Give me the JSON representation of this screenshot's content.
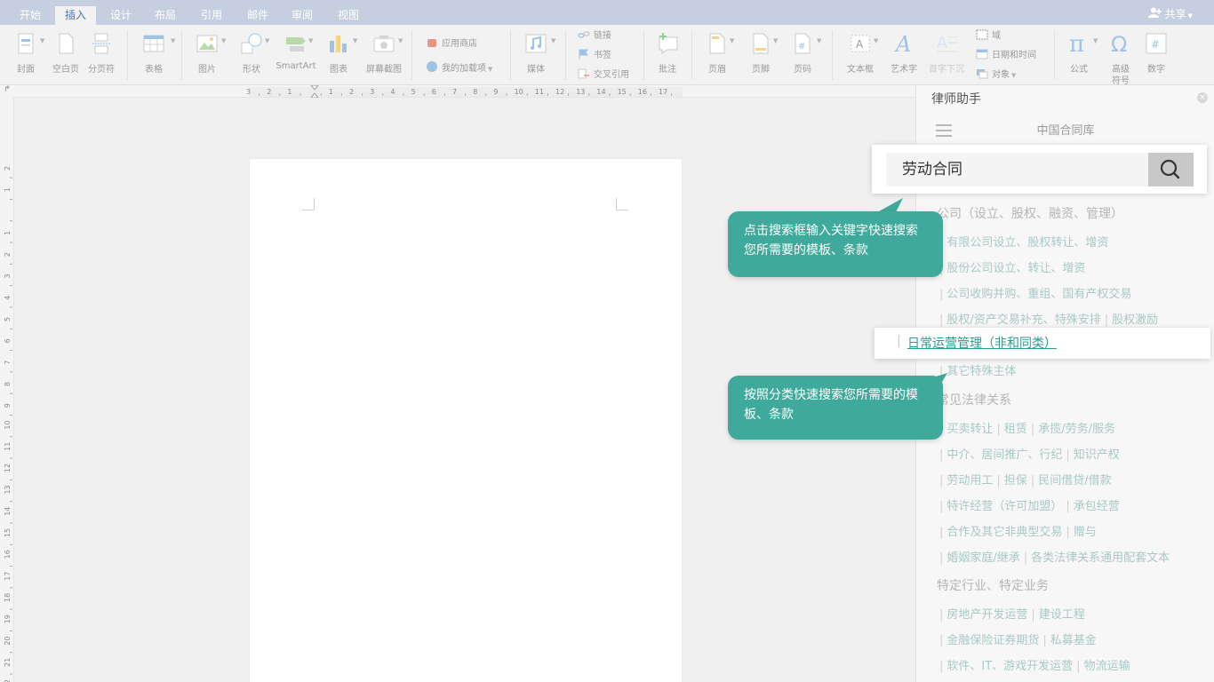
{
  "tabs": [
    {
      "label": "开始",
      "active": false
    },
    {
      "label": "插入",
      "active": true
    },
    {
      "label": "设计",
      "active": false
    },
    {
      "label": "布局",
      "active": false
    },
    {
      "label": "引用",
      "active": false
    },
    {
      "label": "邮件",
      "active": false
    },
    {
      "label": "审阅",
      "active": false
    },
    {
      "label": "视图",
      "active": false
    }
  ],
  "share_label": "共享",
  "ribbon": {
    "cover": "封面",
    "blank_page": "空白页",
    "page_break": "分页符",
    "table": "表格",
    "picture": "图片",
    "shape": "形状",
    "smartart": "SmartArt",
    "chart": "图表",
    "screenshot": "屏幕截图",
    "app_store": "应用商店",
    "my_addins": "我的加载项",
    "media": "媒体",
    "link": "链接",
    "bookmark": "书签",
    "cross_ref": "交叉引用",
    "comment": "批注",
    "header": "页眉",
    "footer": "页脚",
    "page_number": "页码",
    "textbox": "文本框",
    "wordart": "艺术字",
    "dropcap": "首字下沉",
    "field": "域",
    "datetime": "日期和时间",
    "object": "对象",
    "equation": "公式",
    "symbol_line1": "高级",
    "symbol_line2": "符号",
    "number": "数字"
  },
  "panel": {
    "title": "律师助手",
    "library_title": "中国合同库",
    "search_value": "劳动合同",
    "categories": {
      "company_head": "公司（设立、股权、融资、管理）",
      "company_rows": [
        [
          "有限公司设立、股权转让、增资"
        ],
        [
          "股份公司设立、转让、增资"
        ],
        [
          "公司收购并购、重组、国有产权交易"
        ],
        [
          "股权/资产交易补充、特殊安排",
          "股权激励"
        ]
      ],
      "highlight_row": "日常运营管理（非和同类）",
      "other_row": "其它特殊主体",
      "legal_head": "常见法律关系",
      "legal_rows": [
        [
          "买卖转让",
          "租赁",
          "承揽/劳务/服务"
        ],
        [
          "中介、居间推广、行纪",
          "知识产权"
        ],
        [
          "劳动用工",
          "担保",
          "民间借贷/借款"
        ],
        [
          "特许经营（许可加盟）",
          "承包经营"
        ],
        [
          "合作及其它非典型交易",
          "赠与"
        ],
        [
          "婚姻家庭/继承",
          "各类法律关系通用配套文本"
        ]
      ],
      "industry_head": "特定行业、特定业务",
      "industry_rows": [
        [
          "房地产开发运营",
          "建设工程"
        ],
        [
          "金融保险证券期货",
          "私募基金"
        ],
        [
          "软件、IT、游戏开发运营",
          "物流运输"
        ]
      ]
    }
  },
  "callouts": {
    "search_tip": "点击搜索框输入关键字快速搜索您所需要的模板、条款",
    "category_tip": "按照分类快速搜索您所需要的模板、条款"
  },
  "ruler_h": [
    "3",
    "2",
    "1",
    "",
    "1",
    "2",
    "3",
    "4",
    "5",
    "6",
    "7",
    "8",
    "9",
    "10",
    "11",
    "12",
    "13",
    "14",
    "15",
    "16",
    "17"
  ],
  "ruler_v": [
    "2",
    "1",
    "",
    "1",
    "2",
    "3",
    "4",
    "5",
    "6",
    "7",
    "8",
    "9",
    "10",
    "11",
    "12",
    "13",
    "14",
    "15",
    "16",
    "17",
    "18",
    "19",
    "20",
    "21",
    "22"
  ]
}
